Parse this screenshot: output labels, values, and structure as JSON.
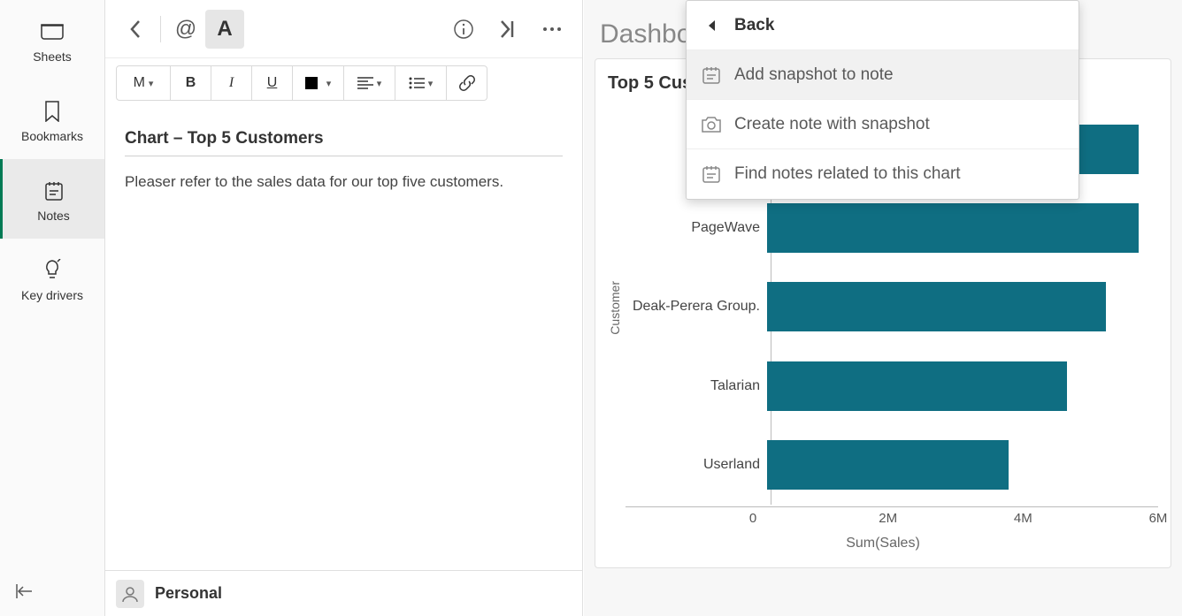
{
  "sidebar": {
    "items": [
      {
        "label": "Sheets"
      },
      {
        "label": "Bookmarks"
      },
      {
        "label": "Notes"
      },
      {
        "label": "Key drivers"
      }
    ]
  },
  "toolbar": {
    "size_label": "M",
    "bold_label": "B",
    "italic_label": "I",
    "underline_label": "U"
  },
  "note": {
    "title": "Chart – Top 5 Customers",
    "body": "Pleaser refer to the sales data for our top five customers."
  },
  "footer": {
    "label": "Personal"
  },
  "dashboard": {
    "title": "Dashboard"
  },
  "chart_title": "Top 5 Customers",
  "chart_data": {
    "type": "bar",
    "orientation": "horizontal",
    "title": "Top 5 Customers",
    "xlabel": "Sum(Sales)",
    "ylabel": "Customer",
    "xlim": [
      0,
      6000000
    ],
    "x_ticks": [
      "0",
      "2M",
      "4M",
      "6M"
    ],
    "categories": [
      "",
      "PageWave",
      "Deak-Perera Group.",
      "Talarian",
      "Userland"
    ],
    "values": [
      5700000,
      5700000,
      5200000,
      4600000,
      3700000
    ],
    "bar_color": "#0f6e82"
  },
  "menu": {
    "back": "Back",
    "items": [
      "Add snapshot to note",
      "Create note with snapshot",
      "Find notes related to this chart"
    ]
  }
}
